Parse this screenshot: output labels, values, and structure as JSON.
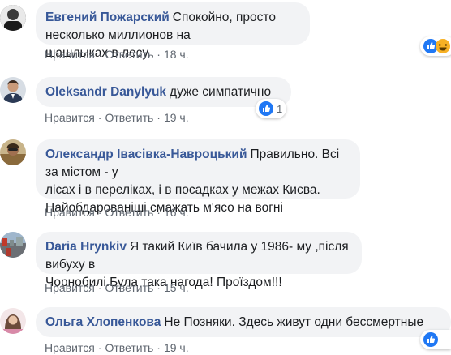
{
  "comments": [
    {
      "author": "Евгений Пожарский",
      "text_lines": [
        "Спокойно, просто несколько миллионов на",
        "шашлыках в лесу.."
      ],
      "like_label": "Нравится",
      "reply_label": "Ответить",
      "time": "18 ч.",
      "reactions": [
        "like-icon",
        "haha-icon"
      ],
      "reaction_count": ""
    },
    {
      "author": "Oleksandr Danylyuk",
      "text_lines": [
        "дуже симпатично"
      ],
      "like_label": "Нравится",
      "reply_label": "Ответить",
      "time": "19 ч.",
      "reactions": [
        "like-icon"
      ],
      "reaction_count": "1"
    },
    {
      "author": "Олександр Івасівка-Навроцький",
      "text_lines": [
        "Правильно. Всі за містом - у",
        "лісах і в переліках, і в посадках у межах Києва.",
        "Найобдарованіші смажать м'ясо на вогні"
      ],
      "like_label": "Нравится",
      "reply_label": "Ответить",
      "time": "16 ч.",
      "reactions": [],
      "reaction_count": ""
    },
    {
      "author": "Daria Hrynkiv",
      "text_lines": [
        "Я такий Київ бачила у 1986- му ,після вибуху в",
        "Чорнобилі.Була така нагода! Проїздом!!!"
      ],
      "like_label": "Нравится",
      "reply_label": "Ответить",
      "time": "15 ч.",
      "reactions": [],
      "reaction_count": ""
    },
    {
      "author": "Ольга Хлопенкова",
      "text_lines": [
        "Не Позняки. Здесь живут одни бессмертные"
      ],
      "like_label": "Нравится",
      "reply_label": "Ответить",
      "time": "19 ч.",
      "reactions": [
        "like-icon"
      ],
      "reaction_count": ""
    }
  ],
  "colors": {
    "author": "#385898",
    "bubble": "#f2f3f5",
    "meta": "#606770",
    "like_blue": "#2078f4",
    "haha_yellow": "#f7b125"
  }
}
